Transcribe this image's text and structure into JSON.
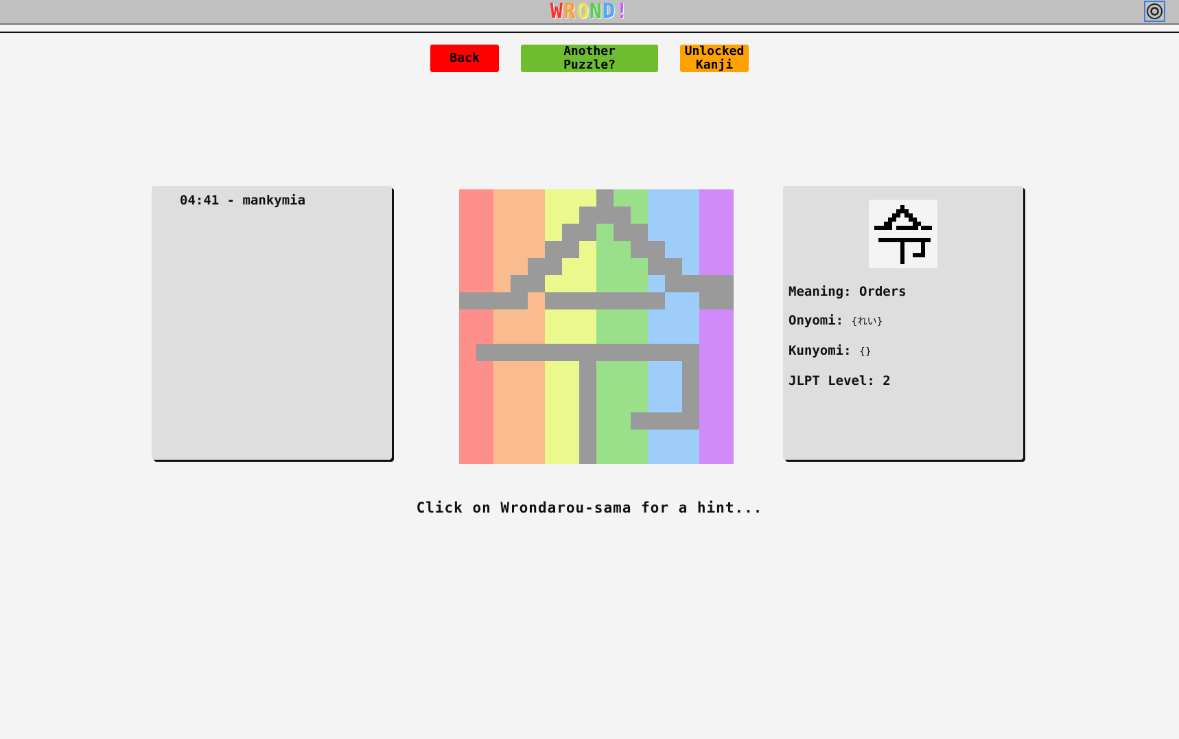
{
  "header": {
    "logo_letters": [
      {
        "ch": "W",
        "color": "#ff2d2d"
      },
      {
        "ch": "R",
        "color": "#ff9d2d"
      },
      {
        "ch": "O",
        "color": "#e8e04a"
      },
      {
        "ch": "N",
        "color": "#4fd04f"
      },
      {
        "ch": "D",
        "color": "#4aa8ff"
      },
      {
        "ch": "!",
        "color": "#c45cff"
      }
    ],
    "settings_icon": "gear-icon"
  },
  "toolbar": {
    "back_label": "Back",
    "another_label_1": "Another",
    "another_label_2": "Puzzle?",
    "unlocked_label_1": "Unlocked",
    "unlocked_label_2": "Kanji"
  },
  "leaderboard": {
    "entries": [
      {
        "time": "04:41",
        "name": "mankymia"
      }
    ]
  },
  "kanji_info": {
    "meaning_label": "Meaning:",
    "meaning_value": "Orders",
    "onyomi_label": "Onyomi:",
    "onyomi_value": "{れい}",
    "kunyomi_label": "Kunyomi:",
    "kunyomi_value": "{}",
    "jlpt_label": "JLPT Level:",
    "jlpt_value": "2"
  },
  "puzzle": {
    "columns": 16,
    "rows": 16,
    "stripe_colors": [
      "#ff8f8a",
      "#ff8f8a",
      "#fabc8e",
      "#fabc8e",
      "#fabc8e",
      "#eaf88e",
      "#eaf88e",
      "#eaf88e",
      "#9ae08a",
      "#9ae08a",
      "#9ae08a",
      "#9dcdf8",
      "#9dcdf8",
      "#9dcdf8",
      "#d08afa",
      "#d08afa"
    ],
    "filled_color": "#9a9a9a",
    "rows_pattern": [
      "0000000010000000",
      "0000000111000000",
      "0000001101100000",
      "0000011000110000",
      "0000110000011000",
      "0001100000001111",
      "1111011111110011",
      "0000000000000000",
      "0000000000000000",
      "0111111111111100",
      "0000000100000100",
      "0000000100000100",
      "0000000100000100",
      "0000000100111100",
      "0000000100000000",
      "0000000100000000"
    ]
  },
  "hint_text": "Click on Wrondarou-sama for a hint..."
}
